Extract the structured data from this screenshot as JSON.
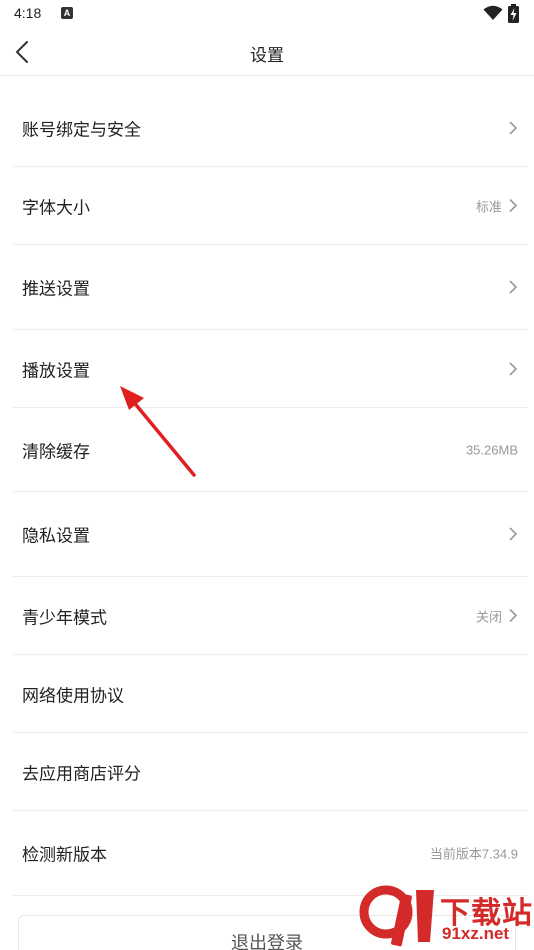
{
  "status_bar": {
    "time": "4:18",
    "notification_badge": "A"
  },
  "nav": {
    "title": "设置",
    "back_icon": "chevron-left-icon"
  },
  "settings": [
    {
      "label": "账号绑定与安全",
      "value": "",
      "chevron": true
    },
    {
      "label": "字体大小",
      "value": "标准",
      "chevron": true
    },
    {
      "label": "推送设置",
      "value": "",
      "chevron": true
    },
    {
      "label": "播放设置",
      "value": "",
      "chevron": true
    },
    {
      "label": "清除缓存",
      "value": "35.26MB",
      "chevron": false
    },
    {
      "label": "隐私设置",
      "value": "",
      "chevron": true
    },
    {
      "label": "青少年模式",
      "value": "关闭",
      "chevron": true
    },
    {
      "label": "网络使用协议",
      "value": "",
      "chevron": false
    },
    {
      "label": "去应用商店评分",
      "value": "",
      "chevron": false
    },
    {
      "label": "检测新版本",
      "value": "当前版本7.34.9",
      "chevron": false
    }
  ],
  "logout": {
    "label": "退出登录"
  },
  "watermark": {
    "title": "下载站",
    "url": "91xz.net"
  },
  "colors": {
    "annotation_arrow": "#e02020",
    "watermark": "#d42a2a",
    "divider": "#eeeeee"
  }
}
